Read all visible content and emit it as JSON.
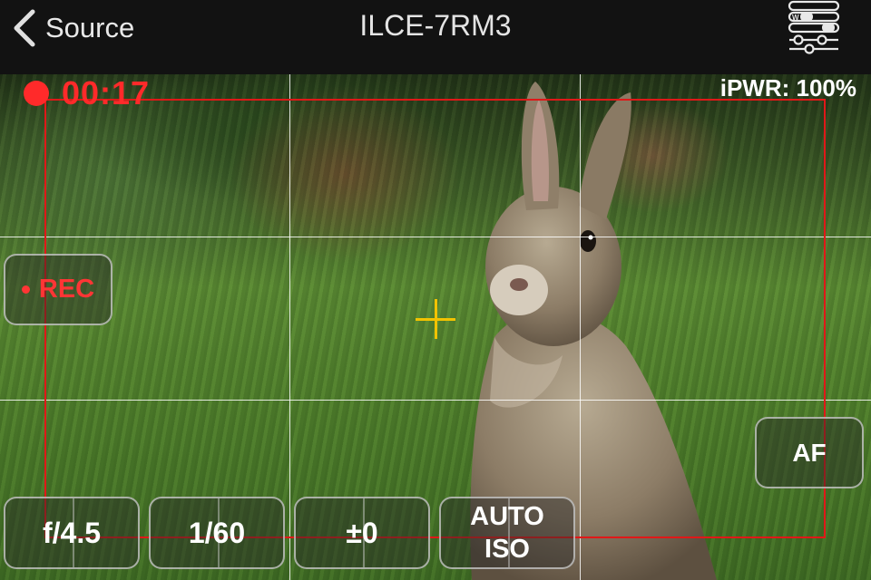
{
  "navbar": {
    "back_label": "Source",
    "title": "ILCE-7RM3",
    "settings_icon": "sliders-icon",
    "settings_icon_letter": "W"
  },
  "status": {
    "timer": "00:17",
    "power": "iPWR: 100%",
    "recording_color": "#ff2a2a"
  },
  "controls": {
    "rec_label": "REC",
    "af_label": "AF",
    "aperture": "f/4.5",
    "shutter": "1/60",
    "exposure": "±0",
    "iso_line1": "AUTO",
    "iso_line2": "ISO"
  },
  "overlay": {
    "frame_color": "#e01818",
    "crosshair_color": "#f2c200"
  }
}
